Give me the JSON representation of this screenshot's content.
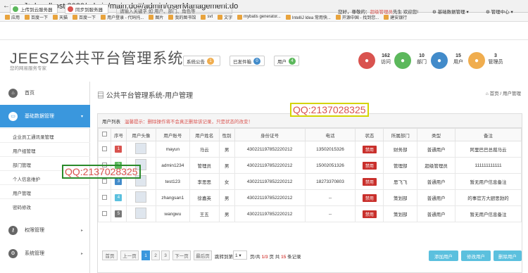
{
  "browser": {
    "url": "localhost:8080/admin/main.do#/admin/userManagement.do"
  },
  "bookmarks": [
    "应用",
    "百度一下",
    "天猫",
    "百度一下",
    "用户登录 - 代码托...",
    "图片",
    "我的图书馆",
    "svt",
    "文字",
    "mybatis generator...",
    "IntelliJ Idea 常用快...",
    "开源中国 - 找到您...",
    "建安银行"
  ],
  "topbar": {
    "upload_btn": "上传到云服务器",
    "sync_btn": "同步到服务器",
    "search_placeholder": "请输入关键字 如:用户、部门、角色等",
    "welcome_prefix": "您好，尊敬的：",
    "welcome_name": "超级管理员",
    "welcome_suffix": "先生 欢迎您!",
    "menu1": "基础数据管理",
    "menu2": "管理中心"
  },
  "header": {
    "logo": "JEESZ公共平台管理系统",
    "slogan": "您的网易服务专家",
    "notice_label": "系统公告",
    "notice_count": "1",
    "mail_label": "已发件箱",
    "mail_count": "0",
    "user_label": "用户",
    "user_count": "4",
    "stats": [
      {
        "value": "162",
        "label": "访问",
        "color": "#d9534f"
      },
      {
        "value": "10",
        "label": "部门",
        "color": "#5cb85c"
      },
      {
        "value": "15",
        "label": "用户",
        "color": "#428bca"
      },
      {
        "value": "3",
        "label": "管理员",
        "color": "#f0ad4e"
      }
    ]
  },
  "sidebar": {
    "home": "首页",
    "basic": "基础数据管理",
    "subs": [
      "企业员工通讯录管理",
      "用户组管理",
      "部门管理",
      "个人信息维护",
      "用户管理",
      "密码修改"
    ],
    "perm": "权限管理",
    "sys": "系统管理"
  },
  "page": {
    "title": "公共平台管理系统-用户管理",
    "crumb_home": "首页",
    "crumb_cur": "用户管理",
    "list_title": "用户列表",
    "warning": "温馨提示：删除操作将不会真正删除该记录，只是状态的改变！"
  },
  "table": {
    "headers": [
      "序号",
      "用户头像",
      "用户账号",
      "用户姓名",
      "性别",
      "身份证号",
      "电话",
      "状态",
      "所属部门",
      "类型",
      "备注"
    ],
    "rows": [
      {
        "no": "1",
        "color": "#d9534f",
        "account": "mayun",
        "name": "马云",
        "sex": "男",
        "id": "430221197852220212",
        "phone": "13502015326",
        "status": "禁用",
        "dept": "财务部",
        "type": "普通用户",
        "note": "阿里巴巴总裁马云"
      },
      {
        "no": "2",
        "color": "#5cb85c",
        "account": "admin1234",
        "name": "管理员",
        "sex": "男",
        "id": "430221197852220212",
        "phone": "15002051326",
        "status": "禁用",
        "dept": "管理部",
        "type": "超级管理员",
        "note": "111111111111"
      },
      {
        "no": "3",
        "color": "#428bca",
        "account": "test123",
        "name": "李思思",
        "sex": "女",
        "id": "430221197852220212",
        "phone": "18273370803",
        "status": "禁用",
        "dept": "思飞飞",
        "type": "普通用户",
        "note": "暂无用户信息备注"
      },
      {
        "no": "4",
        "color": "#5bc0de",
        "account": "zhangsan1",
        "name": "徐嘉英",
        "sex": "男",
        "id": "430221197852220212",
        "phone": "--",
        "status": "禁用",
        "dept": "策划部",
        "type": "普通用户",
        "note": "的事官方大厨思勃的"
      },
      {
        "no": "5",
        "color": "#777777",
        "account": "wangwu",
        "name": "王五",
        "sex": "男",
        "id": "430221197852220212",
        "phone": "--",
        "status": "禁用",
        "dept": "策划部",
        "type": "普通用户",
        "note": "暂无用户信息备注"
      }
    ]
  },
  "pager": {
    "first": "首页",
    "prev": "上一页",
    "p1": "1",
    "p2": "2",
    "p3": "3",
    "next": "下一页",
    "last": "最后页",
    "goto": "跳转到第",
    "sel": "1",
    "page_txt": "页/共",
    "cur": "1/3",
    "total_pre": "页 共",
    "total": "15",
    "total_suf": "条记录",
    "add": "添加用户",
    "edit": "修改用户",
    "del": "删除用户"
  },
  "watermark": "QQ:2137028325"
}
